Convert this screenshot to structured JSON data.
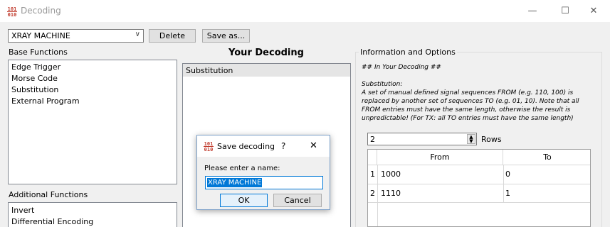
{
  "window": {
    "title": "Decoding",
    "app_icon_top": "101",
    "app_icon_bottom": "010",
    "minimize_glyph": "—",
    "maximize_glyph": "☐",
    "close_glyph": "✕"
  },
  "toolbar": {
    "preset_value": "XRAY MACHINE",
    "delete_label": "Delete",
    "save_as_label": "Save as..."
  },
  "base_functions": {
    "label": "Base Functions",
    "items": [
      "Edge Trigger",
      "Morse Code",
      "Substitution",
      "External Program"
    ]
  },
  "additional_functions": {
    "label": "Additional Functions",
    "items": [
      "Invert",
      "Differential Encoding"
    ]
  },
  "your_decoding": {
    "title": "Your Decoding",
    "items": [
      "Substitution"
    ]
  },
  "info": {
    "group_label": "Information and Options",
    "heading": "## In Your Decoding ##",
    "sub_title": "Substitution:",
    "lines": [
      "A set of manual defined signal sequences FROM (e.g. 110, 100) is",
      "replaced by another set of sequences TO (e.g. 01, 10). Note that all",
      "FROM entries must have the same length, otherwise the result is",
      "unpredictable! (For TX: all TO entries must have the same length)"
    ],
    "rows_value": "2",
    "rows_label": "Rows",
    "table": {
      "headers": [
        "From",
        "To"
      ],
      "rows": [
        {
          "num": "1",
          "from": "1000",
          "to": "0"
        },
        {
          "num": "2",
          "from": "1110",
          "to": "1"
        }
      ]
    }
  },
  "dialog": {
    "title": "Save decoding",
    "help_glyph": "?",
    "close_glyph": "✕",
    "prompt": "Please enter a name:",
    "input_value": "XRAY MACHINE",
    "ok_label": "OK",
    "cancel_label": "Cancel"
  }
}
